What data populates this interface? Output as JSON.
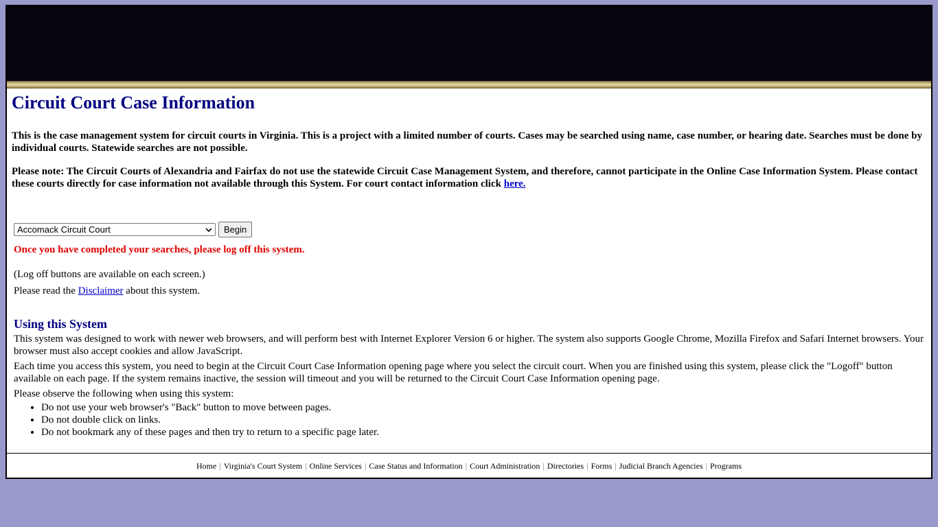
{
  "header": {
    "title": "Circuit Court Case Information"
  },
  "intro": {
    "p1": "This is the case management system for circuit courts in Virginia. This is a project with a limited number of courts. Cases may be searched using name, case number, or hearing date. Searches must be done by individual courts. Statewide searches are not possible.",
    "p2_text": "Please note: The Circuit Courts of Alexandria and Fairfax do not use the statewide Circuit Case Management System, and therefore, cannot participate in the Online Case Information System. Please contact these courts directly for case information not available through this System. For court contact information click ",
    "p2_link": "here."
  },
  "court_selector": {
    "selected": "Accomack Circuit Court",
    "begin_label": "Begin"
  },
  "notices": {
    "logoff_warning": "Once you have completed your searches, please log off this system.",
    "logoff_note": "(Log off buttons are available on each screen.)",
    "disclaimer_prefix": "Please read the ",
    "disclaimer_link": "Disclaimer",
    "disclaimer_suffix": " about this system."
  },
  "usage": {
    "heading": "Using this System",
    "p1": "This system was designed to work with newer web browsers, and will perform best with Internet Explorer Version 6 or higher. The system also supports Google Chrome, Mozilla Firefox and Safari Internet browsers. Your browser must also accept cookies and allow JavaScript.",
    "p2": "Each time you access this system, you need to begin at the Circuit Court Case Information opening page where you select the circuit court. When you are finished using this system, please click the \"Logoff\" button available on each page. If the system remains inactive, the session will timeout and you will be returned to the Circuit Court Case Information opening page.",
    "p3": "Please observe the following when using this system:",
    "rules": [
      "Do not use your web browser's \"Back\" button to move between pages.",
      "Do not double click on links.",
      "Do not bookmark any of these pages and then try to return to a specific page later."
    ]
  },
  "footer": {
    "links": [
      "Home",
      "Virginia's Court System",
      "Online Services",
      "Case Status and Information",
      "Court Administration",
      "Directories",
      "Forms",
      "Judicial Branch Agencies",
      "Programs"
    ],
    "separator": "|"
  },
  "colors": {
    "page_bg": "#9999cc",
    "banner": "#05050f",
    "heading": "#000080",
    "warning": "#e00000",
    "link": "#0000cc"
  }
}
